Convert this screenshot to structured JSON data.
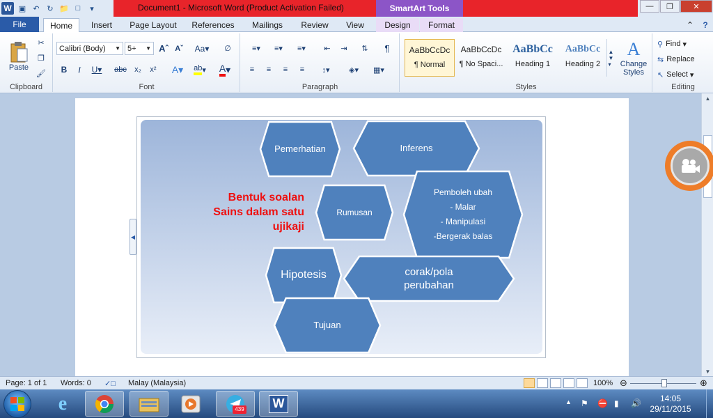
{
  "window": {
    "title": "Document1  -  Microsoft Word (Product Activation Failed)",
    "context_tools": "SmartArt Tools"
  },
  "tabs": [
    "File",
    "Home",
    "Insert",
    "Page Layout",
    "References",
    "Mailings",
    "Review",
    "View",
    "Design",
    "Format"
  ],
  "ribbon": {
    "clipboard": {
      "paste": "Paste",
      "label": "Clipboard"
    },
    "font": {
      "name": "Calibri (Body)",
      "size": "5+",
      "label": "Font"
    },
    "paragraph": {
      "label": "Paragraph"
    },
    "styles": {
      "label": "Styles",
      "items": [
        {
          "preview": "AaBbCcDc",
          "caption": "¶ Normal"
        },
        {
          "preview": "AaBbCcDc",
          "caption": "¶ No Spaci..."
        },
        {
          "preview": "AaBbCc",
          "caption": "Heading 1"
        },
        {
          "preview": "AaBbCc",
          "caption": "Heading 2"
        }
      ],
      "change_line1": "Change",
      "change_line2": "Styles"
    },
    "editing": {
      "find": "Find",
      "replace": "Replace",
      "select": "Select",
      "label": "Editing"
    }
  },
  "smartart": {
    "heading": [
      "Bentuk soalan",
      "Sains dalam  satu",
      "ujikaji"
    ],
    "nodes": {
      "pemerhatian": "Pemerhatian",
      "inferens": "Inferens",
      "rumusan": "Rumusan",
      "pemboleh": [
        "Pemboleh   ubah",
        "- Malar",
        "- Manipulasi",
        "-Bergerak balas"
      ],
      "hipotesis": "Hipotesis",
      "corak": [
        "corak/pola",
        "perubahan"
      ],
      "tujuan": "Tujuan"
    },
    "colors": {
      "fill": "#4f81bd",
      "stroke": "#ffffff",
      "heading": "#ee1111"
    }
  },
  "status": {
    "page": "Page: 1 of 1",
    "words": "Words: 0",
    "language": "Malay (Malaysia)",
    "zoom": "100%"
  },
  "taskbar": {
    "badge": "439",
    "time": "14:05",
    "date": "29/11/2015"
  }
}
